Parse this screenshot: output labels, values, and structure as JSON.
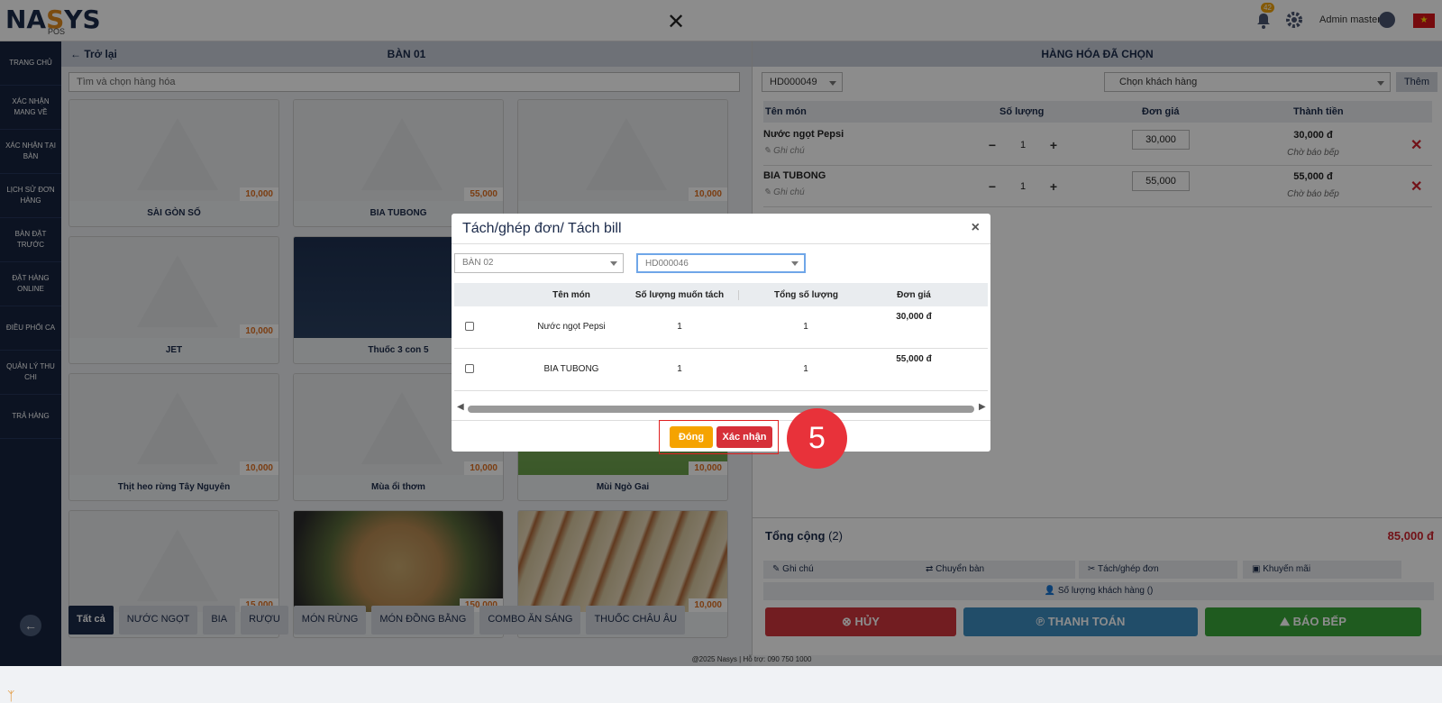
{
  "header": {
    "logo": {
      "prefix": "NA",
      "accent": "S",
      "suffix": "YS",
      "sub": "POS"
    },
    "notification_count": "42",
    "user_name": "Admin master"
  },
  "sidebar": {
    "items": [
      {
        "label": "TRANG CHỦ"
      },
      {
        "label": "XÁC NHẬN MANG VỀ"
      },
      {
        "label": "XÁC NHẬN TẠI BÀN"
      },
      {
        "label": "LỊCH SỬ ĐƠN HÀNG"
      },
      {
        "label": "BÀN ĐẶT TRƯỚC"
      },
      {
        "label": "ĐẶT HÀNG ONLINE"
      },
      {
        "label": "ĐIỀU PHỐI CA"
      },
      {
        "label": "QUẢN LÝ THU CHI"
      },
      {
        "label": "TRẢ HÀNG"
      }
    ]
  },
  "left": {
    "back_label": "Trở lại",
    "table_title": "BÀN 01",
    "search_placeholder": "Tìm và chọn hàng hóa",
    "products": [
      {
        "name": "SÀI GÒN SỐ",
        "price": "10,000"
      },
      {
        "name": "BIA TUBONG",
        "price": "55,000"
      },
      {
        "name": "",
        "price": "10,000"
      },
      {
        "name": "JET",
        "price": "10,000"
      },
      {
        "name": "Thuốc 3 con 5",
        "price": ""
      },
      {
        "name": "",
        "price": ""
      },
      {
        "name": "Thịt heo rừng Tây Nguyên",
        "price": "10,000"
      },
      {
        "name": "Mùa ổi thơm",
        "price": "10,000"
      },
      {
        "name": "Mùi Ngò Gai",
        "price": "10,000"
      },
      {
        "name": "",
        "price": "15,000"
      },
      {
        "name": "",
        "price": "150,000"
      },
      {
        "name": "",
        "price": "10,000"
      }
    ],
    "categories": [
      "Tất cả",
      "NƯỚC NGỌT",
      "BIA",
      "RƯỢU",
      "MÓN RỪNG",
      "MÓN ĐỒNG BẰNG",
      "COMBO ĂN SÁNG",
      "THUỐC CHÂU ÂU"
    ]
  },
  "right": {
    "title": "HÀNG HÓA ĐÃ CHỌN",
    "invoice": "HD000049",
    "customer_placeholder": "Chọn khách hàng",
    "add_label": "Thêm",
    "columns": [
      "Tên món",
      "Số lượng",
      "Đơn giá",
      "Thành tiền"
    ],
    "items": [
      {
        "name": "Nước ngọt Pepsi",
        "note": "Ghi chú",
        "qty": "1",
        "price": "30,000",
        "total": "30,000 đ",
        "status": "Chờ báo bếp"
      },
      {
        "name": "BIA TUBONG",
        "note": "Ghi chú",
        "qty": "1",
        "price": "55,000",
        "total": "55,000 đ",
        "status": "Chờ báo bếp"
      }
    ],
    "total_label": "Tổng cộng",
    "total_count": "(2)",
    "total_amount": "85,000 đ",
    "actions": [
      "Ghi chú",
      "Chuyển bàn",
      "Tách/ghép đơn",
      "Khuyến mãi"
    ],
    "guests_label": "Số lượng khách hàng ()",
    "cancel_label": "HỦY",
    "pay_label": "THANH TOÁN",
    "kitchen_label": "BÁO BẾP"
  },
  "footer": "@2025 Nasys | Hỗ trợ: 090 750 1000",
  "modal": {
    "title": "Tách/ghép đơn/ Tách bill",
    "table_select": "BÀN 02",
    "invoice_select": "HD000046",
    "columns": [
      "Tên món",
      "Số lượng muốn tách",
      "Tổng số lượng",
      "Đơn giá"
    ],
    "rows": [
      {
        "name": "Nước ngọt Pepsi",
        "split_qty": "1",
        "total_qty": "1",
        "price": "30,000 đ"
      },
      {
        "name": "BIA TUBONG",
        "split_qty": "1",
        "total_qty": "1",
        "price": "55,000 đ"
      }
    ],
    "close_label": "Đóng",
    "confirm_label": "Xác nhận"
  },
  "step_number": "5",
  "colors": {
    "navy": "#1b2a4a",
    "accent": "#e08a1e",
    "danger": "#d0222c",
    "pay": "#3c8cc0",
    "kitchen": "#3aa63a"
  }
}
